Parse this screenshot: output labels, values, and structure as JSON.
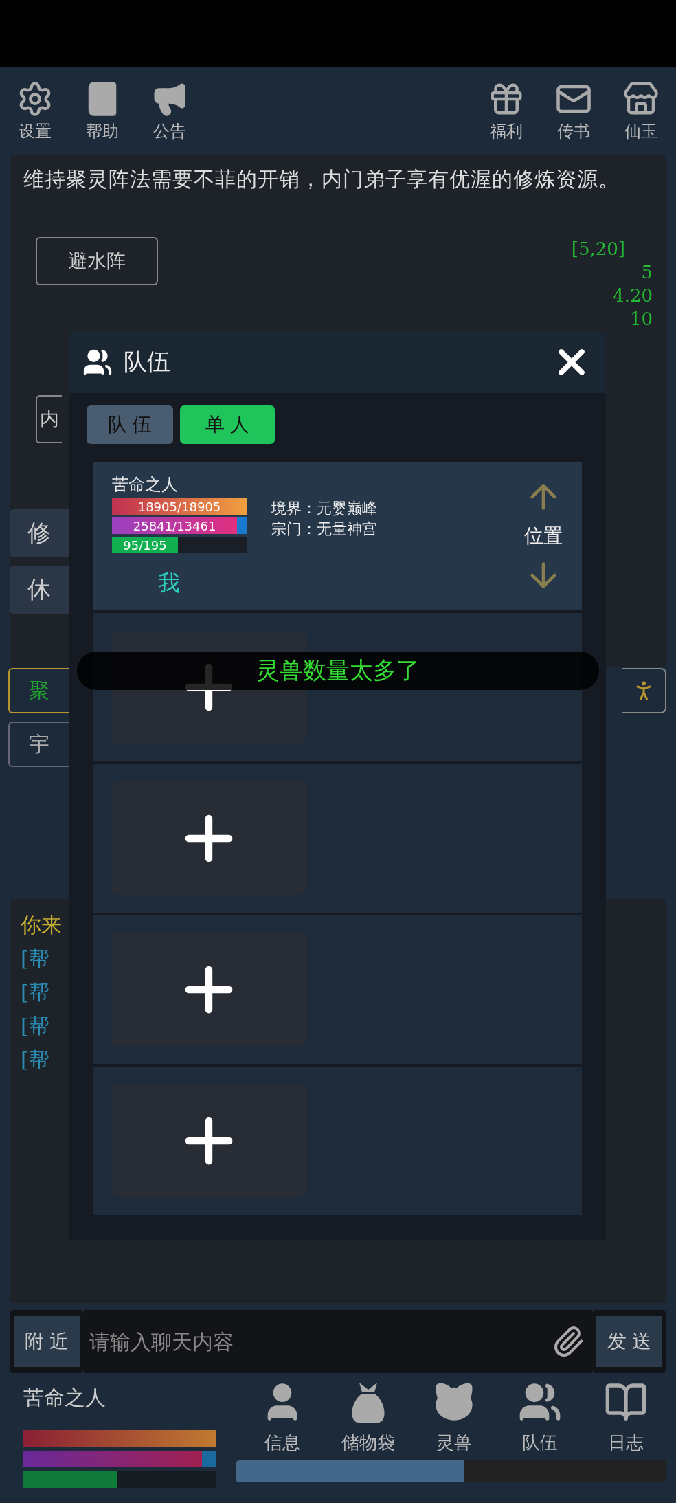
{
  "toolbar": {
    "left": [
      {
        "label": "设置"
      },
      {
        "label": "帮助"
      },
      {
        "label": "公告"
      }
    ],
    "right": [
      {
        "label": "福利"
      },
      {
        "label": "传书"
      },
      {
        "label": "仙玉"
      }
    ]
  },
  "notice": "维持聚灵阵法需要不菲的开销，内门弟子享有优渥的修炼资源。",
  "formation_buttons": [
    {
      "label": "避水阵"
    },
    {
      "label": "内"
    }
  ],
  "stats": [
    "[5,20]",
    "5",
    "4.20",
    "10"
  ],
  "action_buttons": [
    {
      "label": "修"
    },
    {
      "label": "休"
    }
  ],
  "mode_buttons": [
    {
      "label": "聚",
      "selected": true
    },
    {
      "label": "宇",
      "selected": false
    }
  ],
  "chat": [
    {
      "text": "你来",
      "kind": "system"
    },
    {
      "text": "[帮",
      "kind": "help"
    },
    {
      "text": "[帮",
      "kind": "help"
    },
    {
      "text": "[帮",
      "kind": "help"
    },
    {
      "text": "[帮",
      "kind": "help"
    }
  ],
  "chat_input": {
    "channel": "附 近",
    "placeholder": "请输入聊天内容",
    "send": "发 送"
  },
  "player": {
    "name": "苦命之人",
    "bars": [
      {
        "level": 1
      },
      {
        "level": 0.93
      },
      {
        "level": 0.49
      }
    ]
  },
  "nav": [
    {
      "label": "信息"
    },
    {
      "label": "储物袋"
    },
    {
      "label": "灵兽"
    },
    {
      "label": "队伍"
    },
    {
      "label": "日志"
    }
  ],
  "nav_progress": {
    "level": 0.53
  },
  "team_dialog": {
    "title": "队伍",
    "tabs": [
      {
        "label": "队 伍",
        "selected": false
      },
      {
        "label": "单 人",
        "selected": true
      }
    ],
    "slots": [
      {
        "kind": "member",
        "name": "苦命之人",
        "bars": [
          {
            "text": "18905/18905",
            "level": 1
          },
          {
            "text": "25841/13461",
            "level": 0.93
          },
          {
            "text": "95/195",
            "level": 0.49
          }
        ],
        "realm": "境界：元婴巅峰",
        "sect": "宗门：无量神宫",
        "tag": "我",
        "position": "位置"
      },
      {
        "kind": "empty"
      },
      {
        "kind": "empty"
      },
      {
        "kind": "empty"
      },
      {
        "kind": "empty"
      }
    ]
  },
  "toast": "灵兽数量太多了"
}
